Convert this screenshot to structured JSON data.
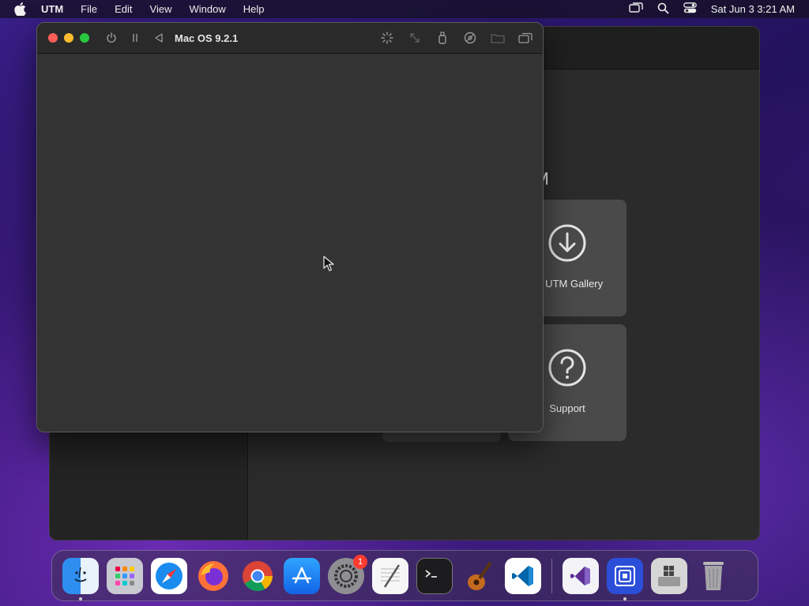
{
  "menubar": {
    "app_name": "UTM",
    "items": [
      "File",
      "Edit",
      "View",
      "Window",
      "Help"
    ],
    "clock": "Sat Jun 3  3:21 AM"
  },
  "vm_window": {
    "title": "Mac OS 9.2.1"
  },
  "main_window": {
    "welcome_fragment": "TM",
    "tiles": [
      {
        "label": "se UTM Gallery",
        "icon": "download-circle-icon"
      },
      {
        "label": "Support",
        "icon": "question-circle-icon"
      }
    ]
  },
  "dock": {
    "items": [
      {
        "name": "finder",
        "running": true
      },
      {
        "name": "launchpad",
        "running": false
      },
      {
        "name": "safari",
        "running": false
      },
      {
        "name": "firefox",
        "running": false
      },
      {
        "name": "chrome",
        "running": false
      },
      {
        "name": "app-store",
        "running": false
      },
      {
        "name": "system-settings",
        "running": false,
        "badge": "1"
      },
      {
        "name": "textedit",
        "running": false
      },
      {
        "name": "terminal",
        "running": false
      },
      {
        "name": "garageband",
        "running": false
      },
      {
        "name": "vscode",
        "running": false
      },
      {
        "name": "visual-studio",
        "running": false
      },
      {
        "name": "utm",
        "running": true
      },
      {
        "name": "boot-camp-assistant",
        "running": false
      },
      {
        "name": "trash",
        "running": false
      }
    ]
  },
  "colors": {
    "close": "#ff5f57",
    "minimize": "#febc2e",
    "maximize": "#28c840",
    "badge": "#ff3b30"
  }
}
